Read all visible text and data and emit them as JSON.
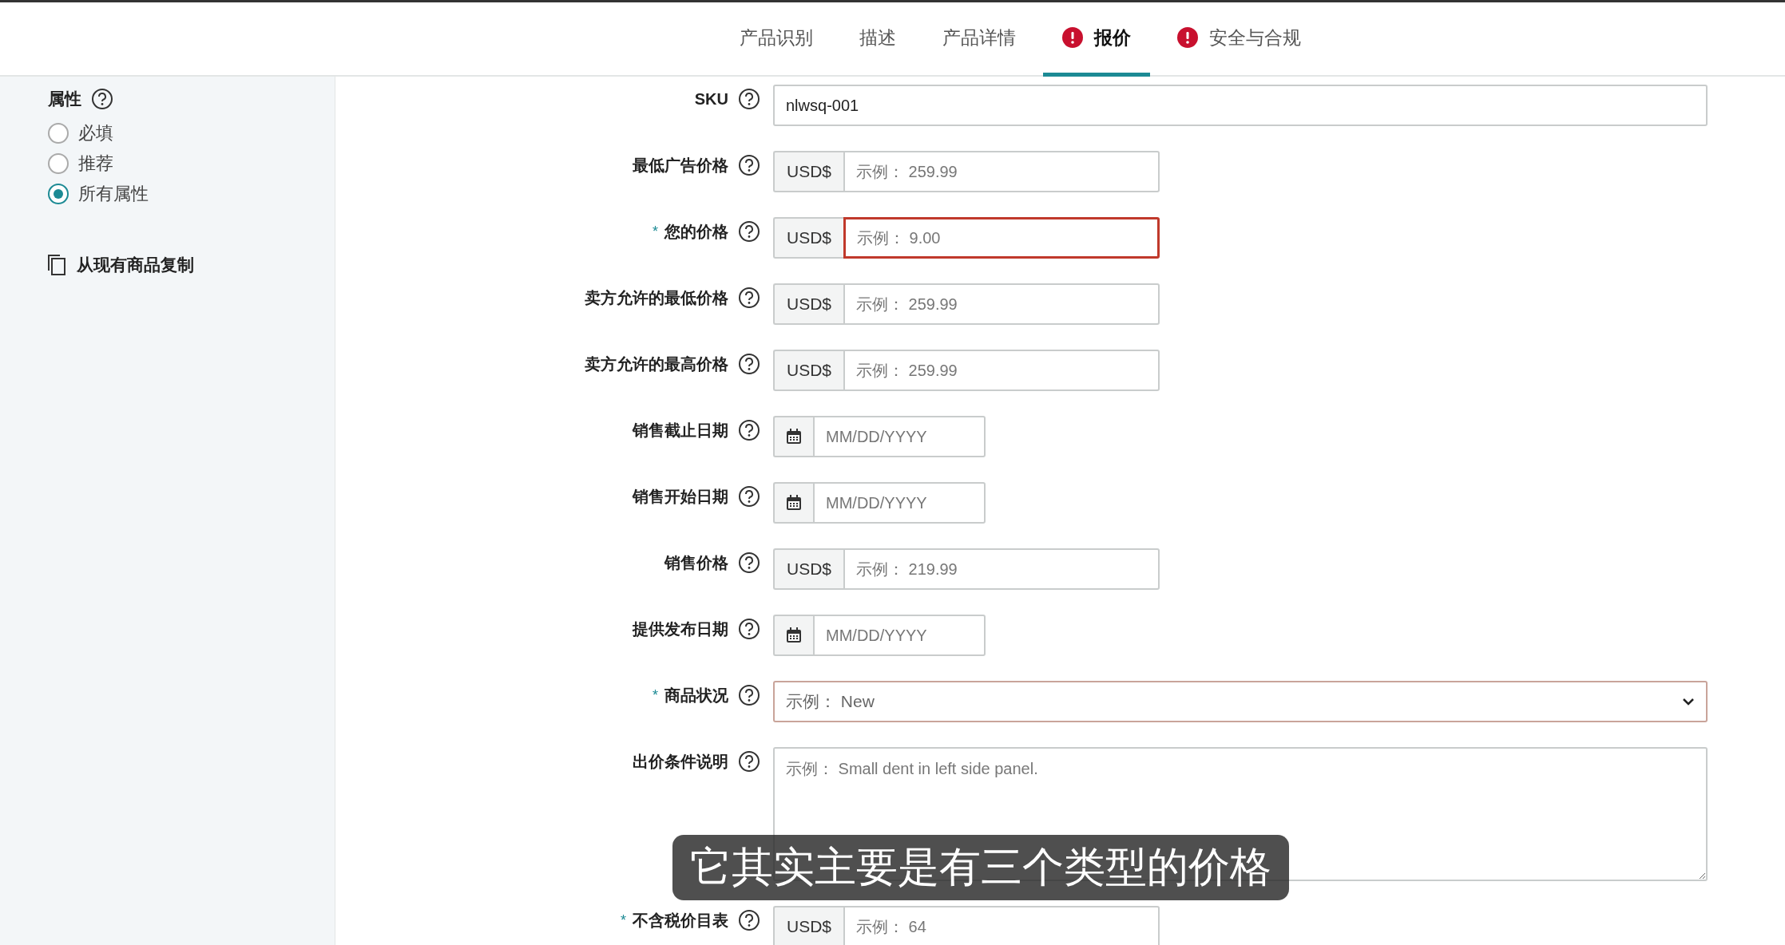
{
  "tabs": [
    {
      "label": "产品识别",
      "selected": false,
      "error": false
    },
    {
      "label": "描述",
      "selected": false,
      "error": false
    },
    {
      "label": "产品详情",
      "selected": false,
      "error": false
    },
    {
      "label": "报价",
      "selected": true,
      "error": true
    },
    {
      "label": "安全与合规",
      "selected": false,
      "error": true
    }
  ],
  "sidebar": {
    "heading": "属性",
    "options": [
      {
        "label": "必填",
        "selected": false
      },
      {
        "label": "推荐",
        "selected": false
      },
      {
        "label": "所有属性",
        "selected": true
      }
    ],
    "copy_link": "从现有商品复制"
  },
  "fields": [
    {
      "kind": "text",
      "label": "SKU",
      "error": false,
      "value": "nlwsq-001"
    },
    {
      "kind": "price",
      "label": "最低广告价格",
      "error": false,
      "prefix": "USD$",
      "placeholder": "示例： 259.99"
    },
    {
      "kind": "price",
      "label": "您的价格",
      "marker": "*",
      "error": true,
      "prefix": "USD$",
      "placeholder": "示例： 9.00"
    },
    {
      "kind": "price",
      "label": "卖方允许的最低价格",
      "error": false,
      "prefix": "USD$",
      "placeholder": "示例： 259.99"
    },
    {
      "kind": "price",
      "label": "卖方允许的最高价格",
      "error": false,
      "prefix": "USD$",
      "placeholder": "示例： 259.99"
    },
    {
      "kind": "date",
      "label": "销售截止日期",
      "error": false,
      "placeholder": "MM/DD/YYYY"
    },
    {
      "kind": "date",
      "label": "销售开始日期",
      "error": false,
      "placeholder": "MM/DD/YYYY"
    },
    {
      "kind": "price",
      "label": "销售价格",
      "error": false,
      "prefix": "USD$",
      "placeholder": "示例： 219.99"
    },
    {
      "kind": "date",
      "label": "提供发布日期",
      "error": false,
      "placeholder": "MM/DD/YYYY"
    },
    {
      "kind": "select",
      "label": "商品状况",
      "marker": "*",
      "error": true,
      "placeholder": "示例： New"
    },
    {
      "kind": "textarea",
      "label": "出价条件说明",
      "error": false,
      "placeholder": "示例： Small dent in left side panel."
    },
    {
      "kind": "price",
      "label": "不含税价目表",
      "marker": "*",
      "error": false,
      "prefix": "USD$",
      "placeholder": "示例： 64"
    }
  ],
  "caption": "它其实主要是有三个类型的价格"
}
